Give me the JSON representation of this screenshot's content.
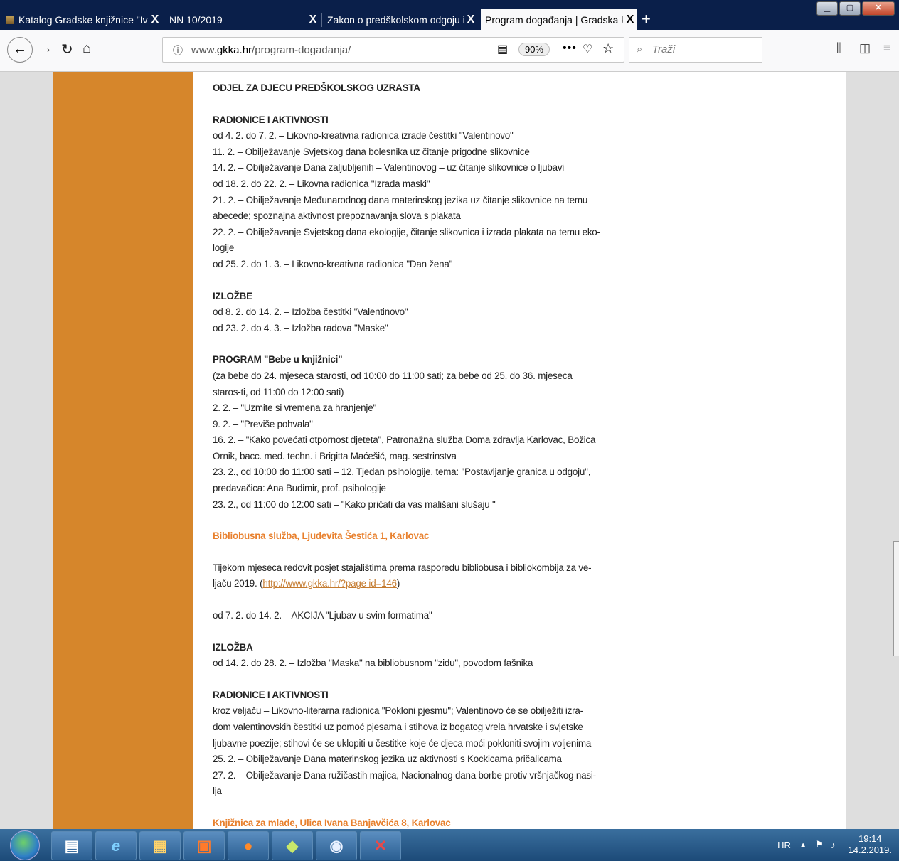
{
  "browser": {
    "tabs": [
      {
        "title": "Katalog Gradske knjižnice \"Ivan",
        "active": false
      },
      {
        "title": "NN 10/2019",
        "active": false
      },
      {
        "title": "Zakon o predškolskom odgoju i na",
        "active": false
      },
      {
        "title": "Program događanja | Gradska knjiž",
        "active": true
      }
    ],
    "tab_close_glyph": "X",
    "new_tab_glyph": "+",
    "url_prefix": "www.",
    "url_domain": "gkka.hr",
    "url_path": "/program-dogadanja/",
    "zoom": "90%",
    "search_placeholder": "Traži"
  },
  "article": {
    "section_title": "ODJEL ZA DJECU PREDŠKOLSKOG UZRASTA",
    "radionice_title": "RADIONICE I AKTIVNOSTI",
    "radionice_items": [
      "od 4. 2. do 7. 2. – Likovno-kreativna radionica izrade čestitki \"Valentinovo\"",
      "11. 2. – Obilježavanje Svjetskog dana bolesnika uz čitanje prigodne slikovnice",
      "14. 2. – Obilježavanje Dana zaljubljenih – Valentinovog – uz čitanje slikovnice o ljubavi",
      "od 18. 2. do 22. 2. – Likovna radionica \"Izrada maski\"",
      "21. 2. – Obilježavanje Međunarodnog dana materinskog jezika uz čitanje slikovnice na temu abecede; spoznajna aktivnost prepoznavanja slova s plakata",
      "22. 2. – Obilježavanje Svjetskog dana ekologije, čitanje slikovnica i izrada plakata na temu eko-logije",
      "od 25. 2. do 1. 3. – Likovno-kreativna radionica \"Dan žena\""
    ],
    "izlozbe_title": "IZLOŽBE",
    "izlozbe_items": [
      "od 8. 2. do 14. 2. – Izložba čestitki \"Valentinovo\"",
      "od 23. 2. do 4. 3. – Izložba radova \"Maske\""
    ],
    "bebe_title": "PROGRAM \"Bebe u knjižnici\"",
    "bebe_items": [
      "(za bebe do 24. mjeseca starosti, od 10:00 do 11:00 sati; za bebe od 25. do 36. mjeseca staros-ti, od 11:00 do 12:00 sati)",
      "2. 2. – \"Uzmite si vremena za hranjenje\"",
      "9. 2. – \"Previše pohvala\"",
      "16. 2. – \"Kako povećati otpornost djeteta\", Patronažna služba Doma zdravlja Karlovac, Božica Ornik, bacc. med. techn. i Brigitta Maćešić, mag. sestrinstva",
      "23. 2., od 10:00 do 11:00 sati – 12. Tjedan psihologije, tema: \"Postavljanje granica u odgoju\", predavačica: Ana Budimir, prof. psihologije",
      "23. 2., od 11:00 do 12:00 sati – \"Kako pričati da vas mališani slušaju \""
    ],
    "bibliobus_title": "Bibliobusna služba, Ljudevita Šestića 1, Karlovac",
    "bibliobus_intro": "Tijekom mjeseca redovit posjet stajalištima prema rasporedu bibliobusa i bibliokombija za ve-ljaču 2019. (",
    "bibliobus_link": "http://www.gkka.hr/?page id=146",
    "bibliobus_intro_end": ")",
    "akcija": "od 7. 2. do 14. 2. – AKCIJA \"Ljubav u svim formatima\"",
    "izlozba_title": "IZLOŽBA",
    "izlozba_item": "od 14. 2. do 28. 2. – Izložba \"Maska\" na bibliobusnom \"zidu\", povodom fašnika",
    "radionice2_title": "RADIONICE I AKTIVNOSTI",
    "radionice2_items": [
      "kroz veljaču – Likovno-literarna radionica \"Pokloni pjesmu\"; Valentinovo će se obilježiti izra-dom valentinovskih čestitki uz pomoć pjesama i stihova iz bogatog vrela hrvatske i svjetske ljubavne poezije; stihovi će se uklopiti u čestitke koje će djeca moći pokloniti svojim voljenima",
      "25. 2. – Obilježavanje Dana materinskog jezika uz aktivnosti s Kockicama pričalicama",
      "27. 2. – Obilježavanje Dana ružičastih majica, Nacionalnog dana borbe protiv vršnjačkog nasi-lja"
    ],
    "next_title": "Knjižnica za mlade, Ulica Ivana Banjavčića 8, Karlovac"
  },
  "taskbar": {
    "language": "HR",
    "time": "19:14",
    "date": "14.2.2019."
  },
  "colors": {
    "accent_orange": "#d6862b",
    "heading_orange": "#e8802d",
    "tabbar": "#0a1f4a"
  }
}
